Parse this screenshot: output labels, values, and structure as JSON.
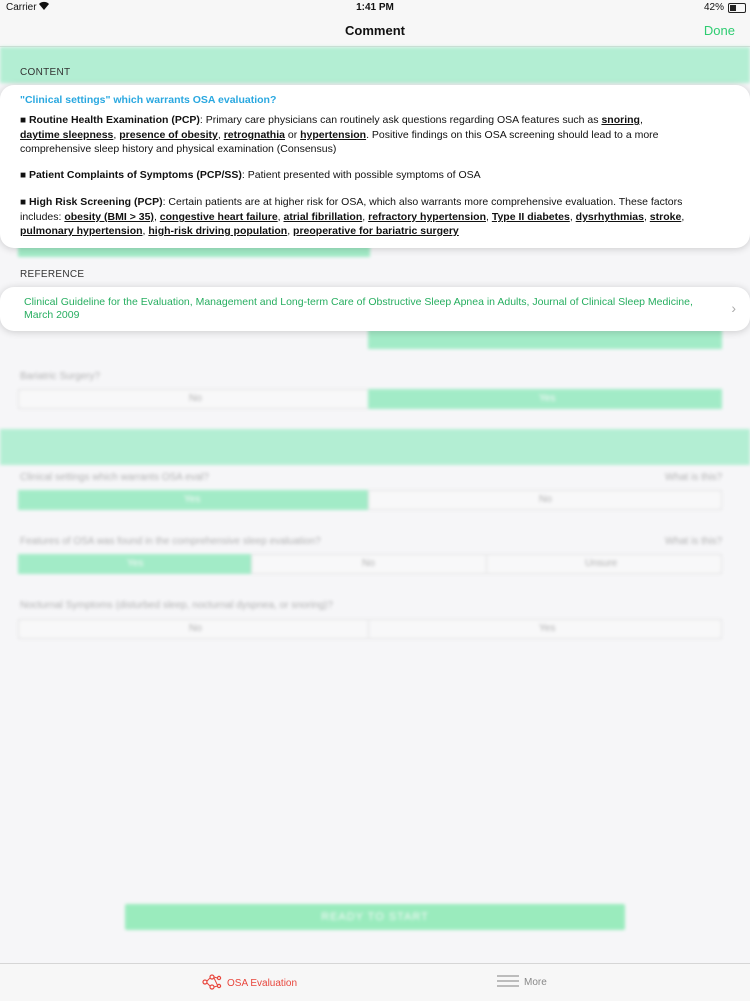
{
  "status": {
    "carrier": "Carrier",
    "time": "1:41 PM",
    "battery": "42%"
  },
  "nav": {
    "title": "Comment",
    "done": "Done"
  },
  "content": {
    "header": "CONTENT",
    "heading": "\"Clinical settings\" which warrants OSA evaluation?",
    "p1": {
      "title": "Routine Health Examination (PCP)",
      "t1": ": Primary care physicians can routinely ask questions regarding OSA features such as ",
      "k1": "snoring",
      "t2": ", ",
      "k2": "daytime sleepness",
      "t3": ", ",
      "k3": "presence of obesity",
      "t4": ", ",
      "k4": "retrognathia",
      "t5": " or ",
      "k5": "hypertension",
      "t6": ". Positive findings on this OSA screening should lead to a more comprehensive sleep history and physical examination (Consensus)"
    },
    "p2": {
      "title": "Patient Complaints of Symptoms (PCP/SS)",
      "text": ": Patient presented with possible symptoms of OSA"
    },
    "p3": {
      "title": "High Risk Screening (PCP)",
      "text": ": Certain patients are at higher risk for OSA, which also warrants more comprehensive evaluation. These factors includes: ",
      "k1": "obesity (BMI > 35)",
      "k2": "congestive heart failure",
      "k3": "atrial fibrillation",
      "k4": "refractory hypertension",
      "k5": "Type II diabetes",
      "k6": "dysrhythmias",
      "k7": "stroke",
      "k8": "pulmonary hypertension",
      "k9": "high-risk driving population",
      "k10": "preoperative for bariatric surgery",
      "sep": ", "
    }
  },
  "reference": {
    "header": "REFERENCE",
    "text": "Clinical Guideline for the Evaluation, Management and Long-term Care of Obstructive Sleep Apnea in Adults, Journal of Clinical Sleep Medicine, March 2009"
  },
  "background": {
    "q_bariatric": "Bariatric Surgery?",
    "no": "No",
    "yes": "Yes",
    "q_clinical": "Clinical settings which warrants OSA eval?",
    "what_is_this": "What is this?",
    "q_features": "Features of OSA was found in the comprehensive sleep evaluation?",
    "unsure": "Unsure",
    "q_nocturnal": "Nocturnal Symptoms (disturbed sleep, nocturnal dyspnea, or snoring)?",
    "ready_button": "READY TO START"
  },
  "tabs": {
    "osa": "OSA Evaluation",
    "more": "More"
  },
  "colors": {
    "accent_green": "#2ecc71",
    "heading_blue": "#2aa8e0",
    "tab_active": "#e8463c"
  }
}
